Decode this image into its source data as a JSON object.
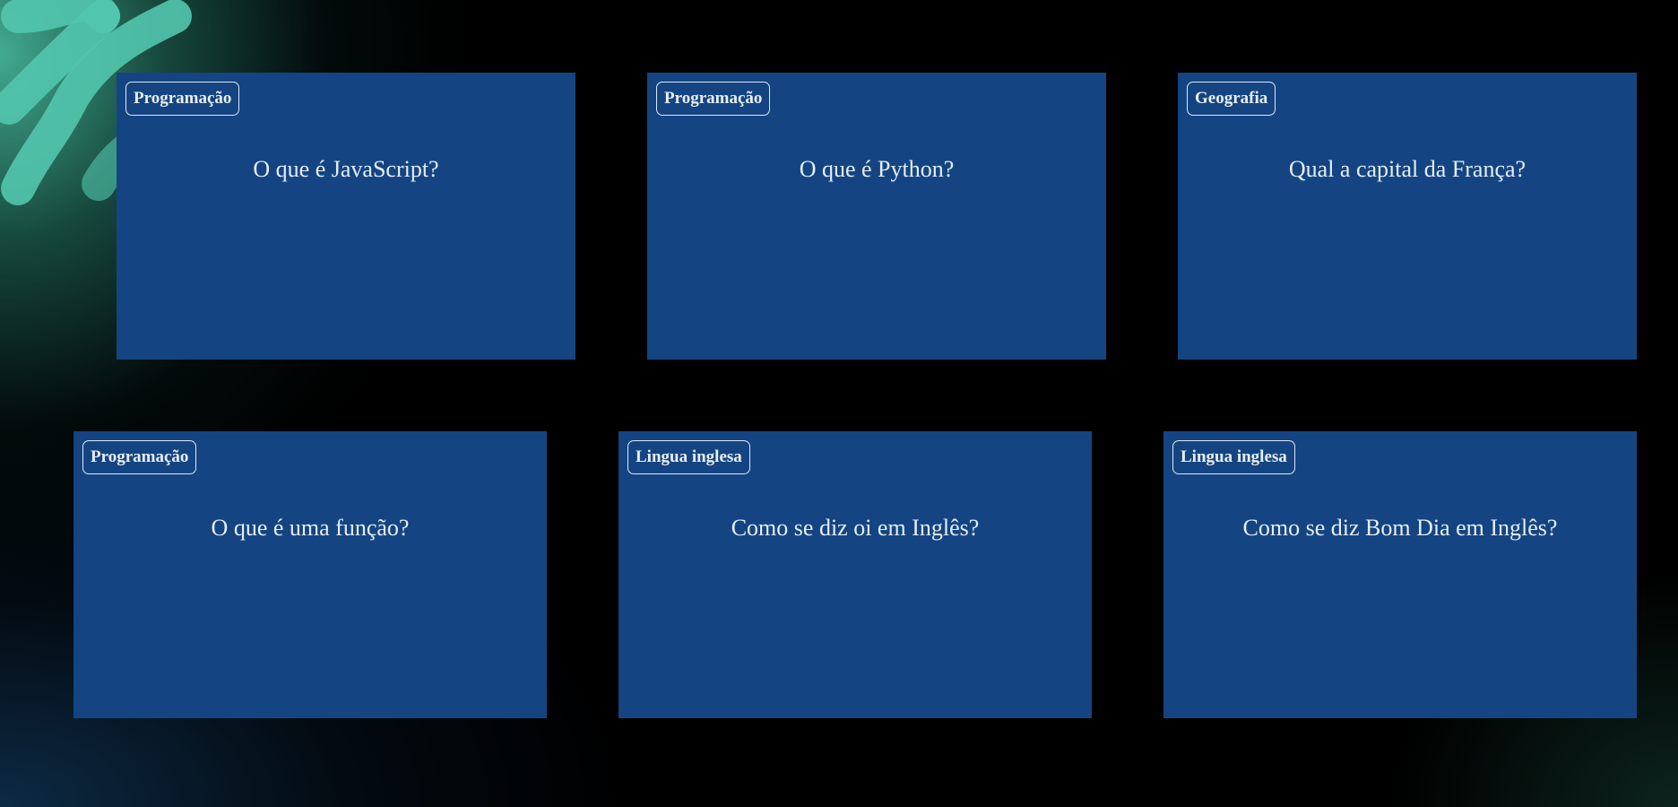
{
  "cards": [
    {
      "category": "Programação",
      "question": "O que é JavaScript?"
    },
    {
      "category": "Programação",
      "question": "O que é Python?"
    },
    {
      "category": "Geografia",
      "question": "Qual a capital da França?"
    },
    {
      "category": "Programação",
      "question": "O que é uma função?"
    },
    {
      "category": "Lingua inglesa",
      "question": "Como se diz oi em Inglês?"
    },
    {
      "category": "Lingua inglesa",
      "question": "Como se diz Bom Dia em Inglês?"
    }
  ],
  "colors": {
    "card_background": "#144582",
    "card_text": "#e6edf5",
    "tag_border": "#dfe8f2",
    "page_background": "#000000",
    "accent_teal": "#4ec8aa"
  },
  "icons": {
    "background_decoration": "swirl-pattern-icon"
  }
}
